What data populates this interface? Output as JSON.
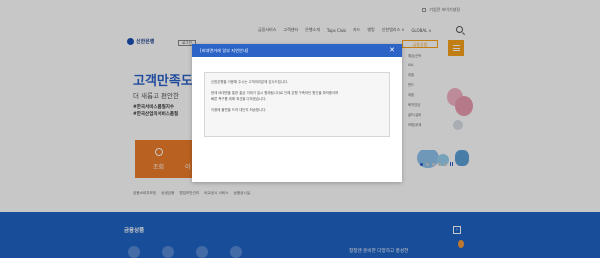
{
  "utility": {
    "checkbox_label": "기업전 보이기설정"
  },
  "header": {
    "logo_text": "신한은행",
    "login_label": "로그인",
    "nav": [
      "금융서비스",
      "고객센터",
      "은행소개",
      "Tops Club",
      "카드",
      "뱅킹",
      "신한앱리스 ∨",
      "GLOBAL ∨"
    ]
  },
  "hero": {
    "title": "고객만족도",
    "subtitle": "더 새롭고 편안한",
    "tag1": "#한국서비스품질지수",
    "tag2": "#한국산업의서비스품질"
  },
  "tiles": {
    "tile1_label": "조회",
    "tile2_label": "이"
  },
  "footer_links": [
    "금융소비자보호",
    "상생금융",
    "멤임보안관리",
    "비교공시 서비스",
    "상품공시실"
  ],
  "product_menu": {
    "header": "금융상품",
    "items": [
      "예금/신탁",
      "ISA",
      "대출",
      "펀드",
      "외환",
      "퇴직연금",
      "골드/실버",
      "보험/공제"
    ]
  },
  "band": {
    "title": "금융상품",
    "arrow": "›",
    "right_text": "청청엔 준비한 다양하고 풍성한"
  },
  "modal": {
    "title": "[비대면거래 일부 지연안내]",
    "close": "✕",
    "line1": "신한은행을 이용해 주시는 고객여러분께 감사드립니다.",
    "line2": "현재 비대면을 통한 출금 거래가 일시 원래됩니다로 인해 은행 구축하던 원인을 파악중이며",
    "line3": "빠른 복구를 위해 최선을 다하겠습니다.",
    "line4": "이용에 불편을 드려 대단히 죄송합니다."
  },
  "colors": {
    "brand_blue": "#2b63c6",
    "accent_orange": "#f7a21b",
    "band_blue": "#1f63c6"
  }
}
